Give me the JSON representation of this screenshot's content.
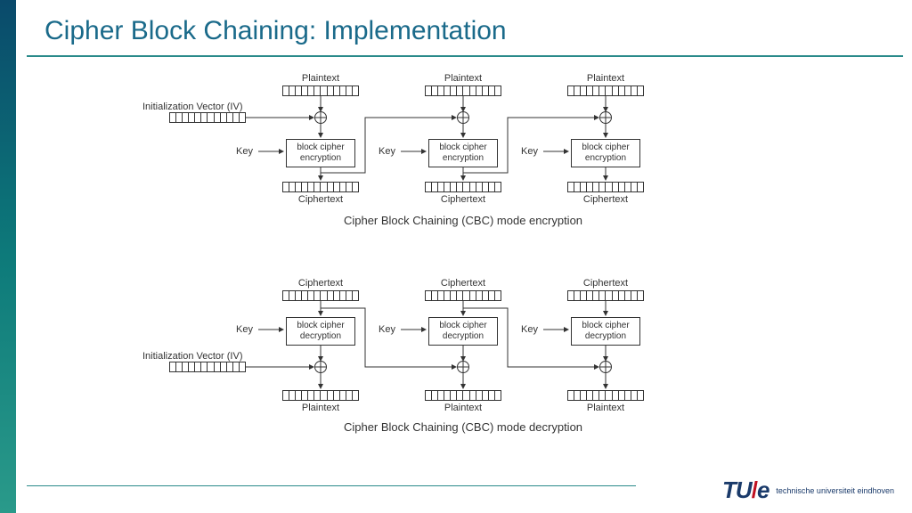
{
  "title": "Cipher Block Chaining: Implementation",
  "labels": {
    "plaintext": "Plaintext",
    "ciphertext": "Ciphertext",
    "iv": "Initialization Vector (IV)",
    "key": "Key",
    "enc_op": "block cipher encryption",
    "dec_op": "block cipher decryption"
  },
  "captions": {
    "enc": "Cipher Block Chaining (CBC) mode encryption",
    "dec": "Cipher Block Chaining (CBC) mode decryption"
  },
  "footer": {
    "logo_tu": "TU",
    "logo_e": "e",
    "uni": "technische universiteit eindhoven"
  }
}
